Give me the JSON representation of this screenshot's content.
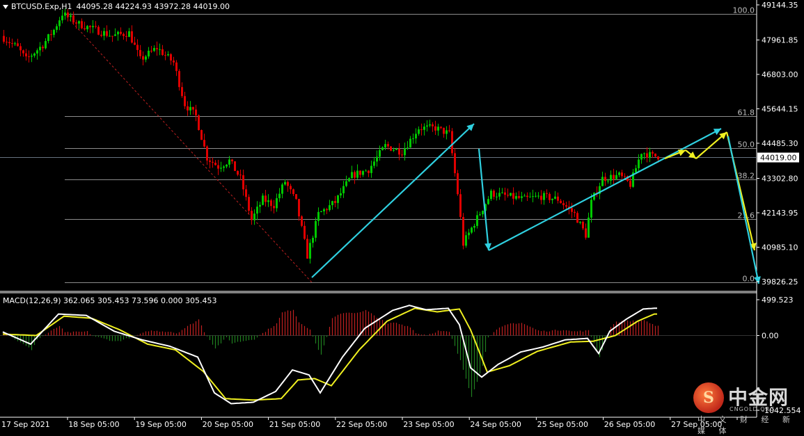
{
  "header": {
    "symbol": "BTCUSD.Exp,H1",
    "ohlc": "44095.28 44224.93 43972.28 44019.00"
  },
  "macd": {
    "label": "MACD(12,26,9) 362.065 305.453 73.596 0.000 305.453",
    "axis_ticks": [
      "499.523",
      "0.00",
      "-1042.554"
    ]
  },
  "watermark": {
    "title": "中金网",
    "sub": "CNGOLD.ORG",
    "tagline": "中 文 财 经 新 媒 体"
  },
  "colors": {
    "bull": "#00c800",
    "bear": "#e00000",
    "grid": "#ffffff",
    "arrow_cyan": "#2fd0e0",
    "arrow_yellow": "#f0f020",
    "macd_line": "#ffffff",
    "signal_line": "#f0f020",
    "hist_pos": "#c02020",
    "hist_neg": "#208020"
  },
  "chart_data": [
    {
      "type": "candlestick",
      "title": "BTCUSD.Exp,H1",
      "ylim": [
        39826.25,
        49144.35
      ],
      "y_ticks": [
        "49144.35",
        "47961.85",
        "46803.00",
        "45644.15",
        "44485.30",
        "43302.80",
        "42143.95",
        "40985.10",
        "39826.25"
      ],
      "current_price": "44019.00",
      "x_ticks": [
        "17 Sep 2021",
        "18 Sep 05:00",
        "19 Sep 05:00",
        "20 Sep 05:00",
        "21 Sep 05:00",
        "22 Sep 05:00",
        "23 Sep 05:00",
        "24 Sep 05:00",
        "25 Sep 05:00",
        "26 Sep 05:00",
        "27 Sep 05:00"
      ],
      "fibonacci": {
        "high": 48850,
        "low": 39800,
        "levels": [
          {
            "label": "100.0",
            "ratio": 1.0
          },
          {
            "label": "61.8",
            "ratio": 0.618
          },
          {
            "label": "50.0",
            "ratio": 0.5
          },
          {
            "label": "38.2",
            "ratio": 0.382
          },
          {
            "label": "23.6",
            "ratio": 0.236
          },
          {
            "label": "0.0",
            "ratio": 0.0
          }
        ]
      },
      "anchors": [
        {
          "i": 0,
          "p": 48100
        },
        {
          "i": 6,
          "p": 47700
        },
        {
          "i": 9,
          "p": 47300
        },
        {
          "i": 15,
          "p": 47800
        },
        {
          "i": 19,
          "p": 48300
        },
        {
          "i": 22,
          "p": 48850
        },
        {
          "i": 28,
          "p": 48500
        },
        {
          "i": 34,
          "p": 48300
        },
        {
          "i": 40,
          "p": 48100
        },
        {
          "i": 46,
          "p": 48200
        },
        {
          "i": 50,
          "p": 47300
        },
        {
          "i": 56,
          "p": 47700
        },
        {
          "i": 62,
          "p": 47200
        },
        {
          "i": 66,
          "p": 45800
        },
        {
          "i": 70,
          "p": 45400
        },
        {
          "i": 74,
          "p": 44000
        },
        {
          "i": 78,
          "p": 43700
        },
        {
          "i": 82,
          "p": 43900
        },
        {
          "i": 86,
          "p": 43300
        },
        {
          "i": 90,
          "p": 41900
        },
        {
          "i": 94,
          "p": 42600
        },
        {
          "i": 98,
          "p": 42400
        },
        {
          "i": 102,
          "p": 43200
        },
        {
          "i": 106,
          "p": 42500
        },
        {
          "i": 110,
          "p": 40700
        },
        {
          "i": 114,
          "p": 42100
        },
        {
          "i": 120,
          "p": 42500
        },
        {
          "i": 126,
          "p": 43400
        },
        {
          "i": 132,
          "p": 43600
        },
        {
          "i": 138,
          "p": 44400
        },
        {
          "i": 144,
          "p": 44200
        },
        {
          "i": 150,
          "p": 45000
        },
        {
          "i": 156,
          "p": 45000
        },
        {
          "i": 161,
          "p": 44800
        },
        {
          "i": 164,
          "p": 42800
        },
        {
          "i": 166,
          "p": 41100
        },
        {
          "i": 170,
          "p": 41800
        },
        {
          "i": 176,
          "p": 42800
        },
        {
          "i": 182,
          "p": 42700
        },
        {
          "i": 188,
          "p": 42600
        },
        {
          "i": 194,
          "p": 42700
        },
        {
          "i": 200,
          "p": 42600
        },
        {
          "i": 206,
          "p": 42100
        },
        {
          "i": 210,
          "p": 41400
        },
        {
          "i": 212,
          "p": 42500
        },
        {
          "i": 216,
          "p": 43300
        },
        {
          "i": 222,
          "p": 43400
        },
        {
          "i": 226,
          "p": 43100
        },
        {
          "i": 230,
          "p": 44200
        },
        {
          "i": 234,
          "p": 44050
        }
      ],
      "arrows": [
        {
          "color": "cyan",
          "points": [
            [
              448,
              399
            ],
            [
              681,
              178
            ]
          ]
        },
        {
          "color": "cyan",
          "points": [
            [
              688,
              214
            ],
            [
              702,
              360
            ]
          ]
        },
        {
          "color": "cyan",
          "points": [
            [
              702,
              360
            ],
            [
              1036,
              185
            ]
          ]
        },
        {
          "color": "yellow",
          "points": [
            [
              955,
              228
            ],
            [
              985,
              216
            ]
          ]
        },
        {
          "color": "yellow",
          "points": [
            [
              985,
              216
            ],
            [
              1000,
              228
            ]
          ]
        },
        {
          "color": "yellow",
          "points": [
            [
              1000,
              228
            ],
            [
              1044,
              190
            ]
          ]
        },
        {
          "color": "yellow",
          "points": [
            [
              1044,
              190
            ],
            [
              1084,
              360
            ]
          ]
        },
        {
          "color": "cyan",
          "points": [
            [
              1046,
              196
            ],
            [
              1090,
              408
            ]
          ]
        }
      ]
    },
    {
      "type": "macd",
      "title": "MACD(12,26,9)",
      "ylim": [
        -1042.554,
        499.523
      ],
      "macd_anchors": [
        {
          "i": 0,
          "v": 50
        },
        {
          "i": 10,
          "v": -120
        },
        {
          "i": 20,
          "v": 300
        },
        {
          "i": 30,
          "v": 280
        },
        {
          "i": 40,
          "v": 60
        },
        {
          "i": 50,
          "v": -60
        },
        {
          "i": 60,
          "v": -150
        },
        {
          "i": 70,
          "v": -300
        },
        {
          "i": 76,
          "v": -800
        },
        {
          "i": 82,
          "v": -950
        },
        {
          "i": 90,
          "v": -930
        },
        {
          "i": 98,
          "v": -780
        },
        {
          "i": 104,
          "v": -480
        },
        {
          "i": 110,
          "v": -550
        },
        {
          "i": 114,
          "v": -800
        },
        {
          "i": 122,
          "v": -300
        },
        {
          "i": 130,
          "v": 100
        },
        {
          "i": 140,
          "v": 350
        },
        {
          "i": 146,
          "v": 420
        },
        {
          "i": 152,
          "v": 360
        },
        {
          "i": 160,
          "v": 380
        },
        {
          "i": 164,
          "v": 150
        },
        {
          "i": 168,
          "v": -450
        },
        {
          "i": 172,
          "v": -580
        },
        {
          "i": 178,
          "v": -400
        },
        {
          "i": 186,
          "v": -230
        },
        {
          "i": 194,
          "v": -160
        },
        {
          "i": 202,
          "v": -60
        },
        {
          "i": 210,
          "v": -40
        },
        {
          "i": 214,
          "v": -250
        },
        {
          "i": 218,
          "v": 60
        },
        {
          "i": 224,
          "v": 230
        },
        {
          "i": 230,
          "v": 370
        },
        {
          "i": 234,
          "v": 380
        }
      ],
      "signal_anchors": [
        {
          "i": 0,
          "v": 20
        },
        {
          "i": 12,
          "v": 0
        },
        {
          "i": 22,
          "v": 270
        },
        {
          "i": 32,
          "v": 240
        },
        {
          "i": 42,
          "v": 80
        },
        {
          "i": 52,
          "v": -120
        },
        {
          "i": 62,
          "v": -200
        },
        {
          "i": 72,
          "v": -500
        },
        {
          "i": 80,
          "v": -880
        },
        {
          "i": 90,
          "v": -900
        },
        {
          "i": 100,
          "v": -880
        },
        {
          "i": 106,
          "v": -620
        },
        {
          "i": 112,
          "v": -600
        },
        {
          "i": 118,
          "v": -700
        },
        {
          "i": 128,
          "v": -200
        },
        {
          "i": 138,
          "v": 200
        },
        {
          "i": 148,
          "v": 380
        },
        {
          "i": 156,
          "v": 330
        },
        {
          "i": 164,
          "v": 370
        },
        {
          "i": 168,
          "v": 80
        },
        {
          "i": 174,
          "v": -510
        },
        {
          "i": 182,
          "v": -420
        },
        {
          "i": 192,
          "v": -220
        },
        {
          "i": 204,
          "v": -90
        },
        {
          "i": 212,
          "v": -80
        },
        {
          "i": 220,
          "v": 0
        },
        {
          "i": 228,
          "v": 200
        },
        {
          "i": 234,
          "v": 300
        }
      ]
    }
  ]
}
